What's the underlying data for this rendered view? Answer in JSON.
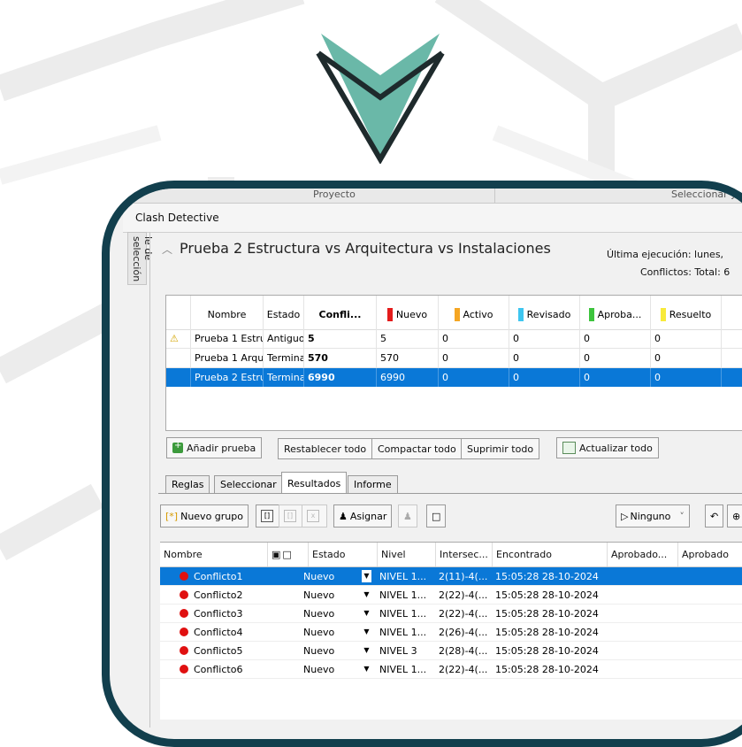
{
  "colors": {
    "frame": "#123f4d",
    "arrow_fill": "#6ab8a8",
    "arrow_stroke": "#1e2a2c",
    "selected_row": "#0a78d7",
    "status_nuevo": "#e41b1b",
    "status_activo": "#f5a623",
    "status_revisado": "#3ec6f0",
    "status_aprobado": "#3dc43d",
    "status_resuelto": "#f8ea3a",
    "conflict_dot": "#e01010"
  },
  "top_strip": {
    "left": "Proyecto",
    "right": "Seleccionar y co"
  },
  "window": {
    "title": "Clash Detective",
    "side_tab": "le de selección"
  },
  "test": {
    "name": "Prueba 2 Estructura vs Arquitectura vs Instalaciones",
    "last_run": "Última ejecución:  lunes,",
    "conflicts_total": "Conflictos:  Total:  6"
  },
  "tests_table": {
    "headers": [
      "Nombre",
      "Estado",
      "Confli...",
      "Nuevo",
      "Activo",
      "Revisado",
      "Aproba...",
      "Resuelto"
    ],
    "rows": [
      {
        "warn": "⚠",
        "nombre": "Prueba 1 Estru",
        "estado": "Antiguo",
        "conflictos": "5",
        "nuevo": "5",
        "activo": "0",
        "revisado": "0",
        "aprobado": "0",
        "resuelto": "0"
      },
      {
        "warn": "",
        "nombre": "Prueba 1 Arqu",
        "estado": "Terminado",
        "conflictos": "570",
        "nuevo": "570",
        "activo": "0",
        "revisado": "0",
        "aprobado": "0",
        "resuelto": "0"
      },
      {
        "warn": "",
        "nombre": "Prueba 2 Estru",
        "estado": "Terminado",
        "conflictos": "6990",
        "nuevo": "6990",
        "activo": "0",
        "revisado": "0",
        "aprobado": "0",
        "resuelto": "0"
      }
    ]
  },
  "buttons": {
    "add_test": "Añadir prueba",
    "reset_all": "Restablecer todo",
    "compact_all": "Compactar todo",
    "delete_all": "Suprimir todo",
    "update_all": "Actualizar todo"
  },
  "tabs": [
    "Reglas",
    "Seleccionar",
    "Resultados",
    "Informe"
  ],
  "results_toolbar": {
    "new_group": "Nuevo grupo",
    "assign": "Asignar",
    "none_dropdown": "Ninguno"
  },
  "results_table": {
    "headers": [
      "Nombre",
      "Estado",
      "Nivel",
      "Intersec...",
      "Encontrado",
      "Aprobado...",
      "Aprobado"
    ],
    "rows": [
      {
        "nombre": "Conflicto1",
        "estado": "Nuevo",
        "nivel": "NIVEL 1...",
        "interseccion": "2(11)-4(...",
        "encontrado": "15:05:28 28-10-2024"
      },
      {
        "nombre": "Conflicto2",
        "estado": "Nuevo",
        "nivel": "NIVEL 1...",
        "interseccion": "2(22)-4(...",
        "encontrado": "15:05:28 28-10-2024"
      },
      {
        "nombre": "Conflicto3",
        "estado": "Nuevo",
        "nivel": "NIVEL 1...",
        "interseccion": "2(22)-4(...",
        "encontrado": "15:05:28 28-10-2024"
      },
      {
        "nombre": "Conflicto4",
        "estado": "Nuevo",
        "nivel": "NIVEL 1...",
        "interseccion": "2(26)-4(...",
        "encontrado": "15:05:28 28-10-2024"
      },
      {
        "nombre": "Conflicto5",
        "estado": "Nuevo",
        "nivel": "NIVEL 3",
        "interseccion": "2(28)-4(...",
        "encontrado": "15:05:28 28-10-2024"
      },
      {
        "nombre": "Conflicto6",
        "estado": "Nuevo",
        "nivel": "NIVEL 1...",
        "interseccion": "2(22)-4(...",
        "encontrado": "15:05:28 28-10-2024"
      }
    ]
  }
}
